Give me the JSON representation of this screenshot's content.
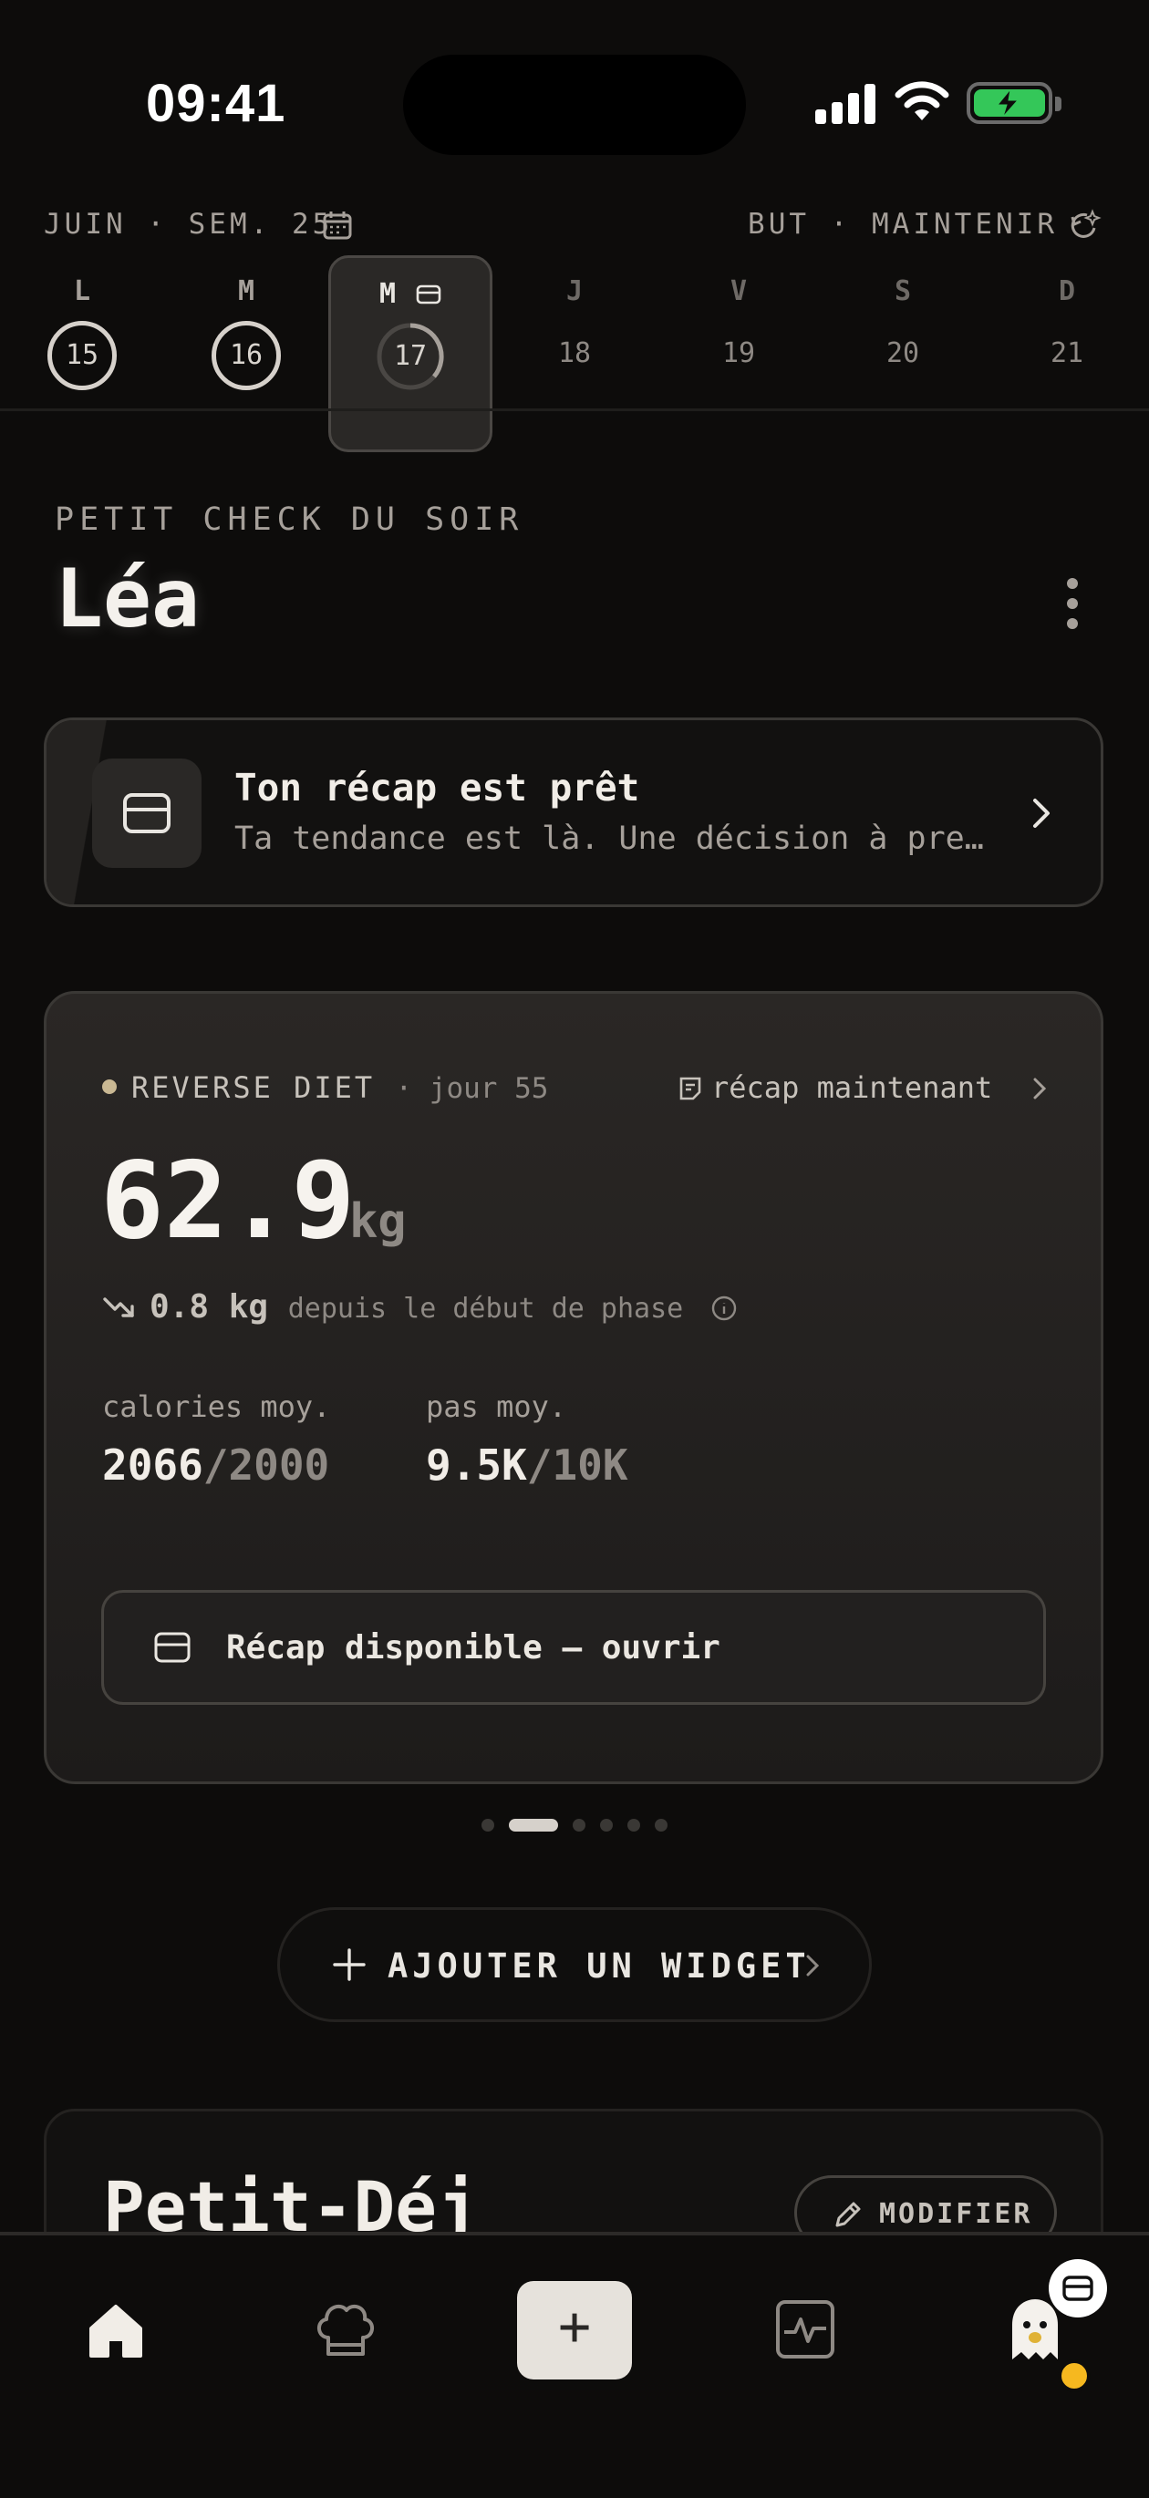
{
  "status_bar": {
    "time": "09:41"
  },
  "week": {
    "label": "JUIN · SEM. 25",
    "goal": "BUT · MAINTENIR",
    "days": [
      {
        "letter": "L",
        "num": "15",
        "state": "done"
      },
      {
        "letter": "M",
        "num": "16",
        "state": "done"
      },
      {
        "letter": "M",
        "num": "17",
        "state": "selected"
      },
      {
        "letter": "J",
        "num": "18",
        "state": "future"
      },
      {
        "letter": "V",
        "num": "19",
        "state": "future"
      },
      {
        "letter": "S",
        "num": "20",
        "state": "future"
      },
      {
        "letter": "D",
        "num": "21",
        "state": "future"
      }
    ]
  },
  "greeting": {
    "eyebrow": "PETIT CHECK DU SOIR",
    "name": "Léa"
  },
  "recap_card": {
    "title": "Ton récap est prêt",
    "subtitle": "Ta tendance est là. Une décision à prendre."
  },
  "weight_widget": {
    "phase": "REVERSE DIET",
    "phase_day": "· jour 55",
    "recap_link": "récap maintenant",
    "weight": "62.9",
    "unit": "kg",
    "delta_value": "0.8 kg",
    "delta_text": "depuis le début de phase",
    "stats": [
      {
        "label": "calories moy.",
        "value": "2066",
        "target": "/2000"
      },
      {
        "label": "pas moy.",
        "value": "9.5K",
        "target": "/10K"
      }
    ],
    "open_button": "Récap disponible — ouvrir"
  },
  "pager": {
    "count": 6,
    "active": 1
  },
  "add_widget": "AJOUTER UN WIDGET",
  "meal_card": {
    "title": "Petit-Déj",
    "edit": "MODIFIER"
  },
  "tabbar": {
    "items": [
      "home-icon",
      "chef-hat-icon",
      "plus-icon",
      "activity-icon",
      "ghost-avatar-icon"
    ],
    "fab_symbol": "+",
    "notification_color": "#f6b81f"
  }
}
